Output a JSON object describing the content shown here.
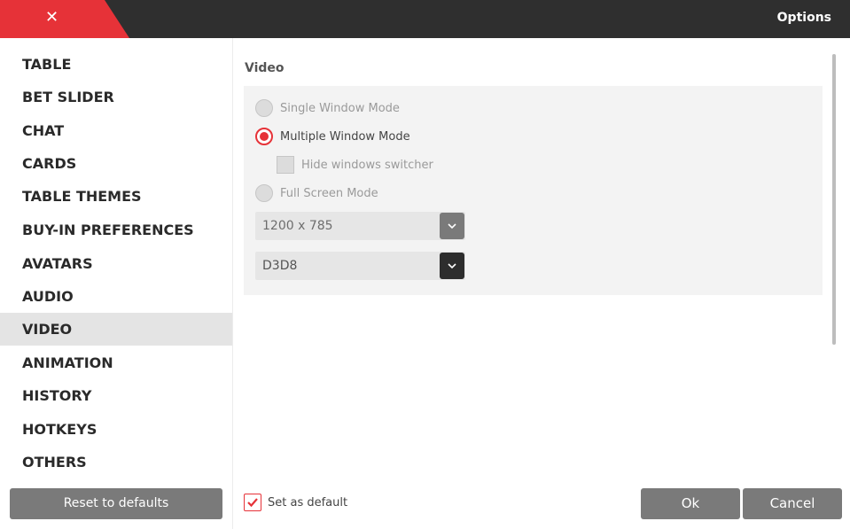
{
  "window": {
    "title": "Options",
    "close_glyph": "✕",
    "accent_color": "#e63238"
  },
  "sidebar": {
    "items": [
      {
        "label": "TABLE"
      },
      {
        "label": "BET SLIDER"
      },
      {
        "label": "CHAT"
      },
      {
        "label": "CARDS"
      },
      {
        "label": "TABLE THEMES"
      },
      {
        "label": "BUY-IN PREFERENCES"
      },
      {
        "label": "AVATARS"
      },
      {
        "label": "AUDIO"
      },
      {
        "label": "VIDEO",
        "active": true
      },
      {
        "label": "ANIMATION"
      },
      {
        "label": "HISTORY"
      },
      {
        "label": "HOTKEYS"
      },
      {
        "label": "OTHERS"
      }
    ],
    "reset_label": "Reset to defaults"
  },
  "video": {
    "title": "Video",
    "modes": [
      {
        "label": "Single Window Mode",
        "checked": false
      },
      {
        "label": "Multiple Window Mode",
        "checked": true
      },
      {
        "label": "Full Screen Mode",
        "checked": false
      }
    ],
    "hide_switcher": {
      "label": "Hide windows switcher",
      "checked": false
    },
    "resolution": "1200 x 785",
    "renderer": "D3D8"
  },
  "footer": {
    "set_default": {
      "label": "Set as default",
      "checked": true
    },
    "ok_label": "Ok",
    "cancel_label": "Cancel"
  }
}
